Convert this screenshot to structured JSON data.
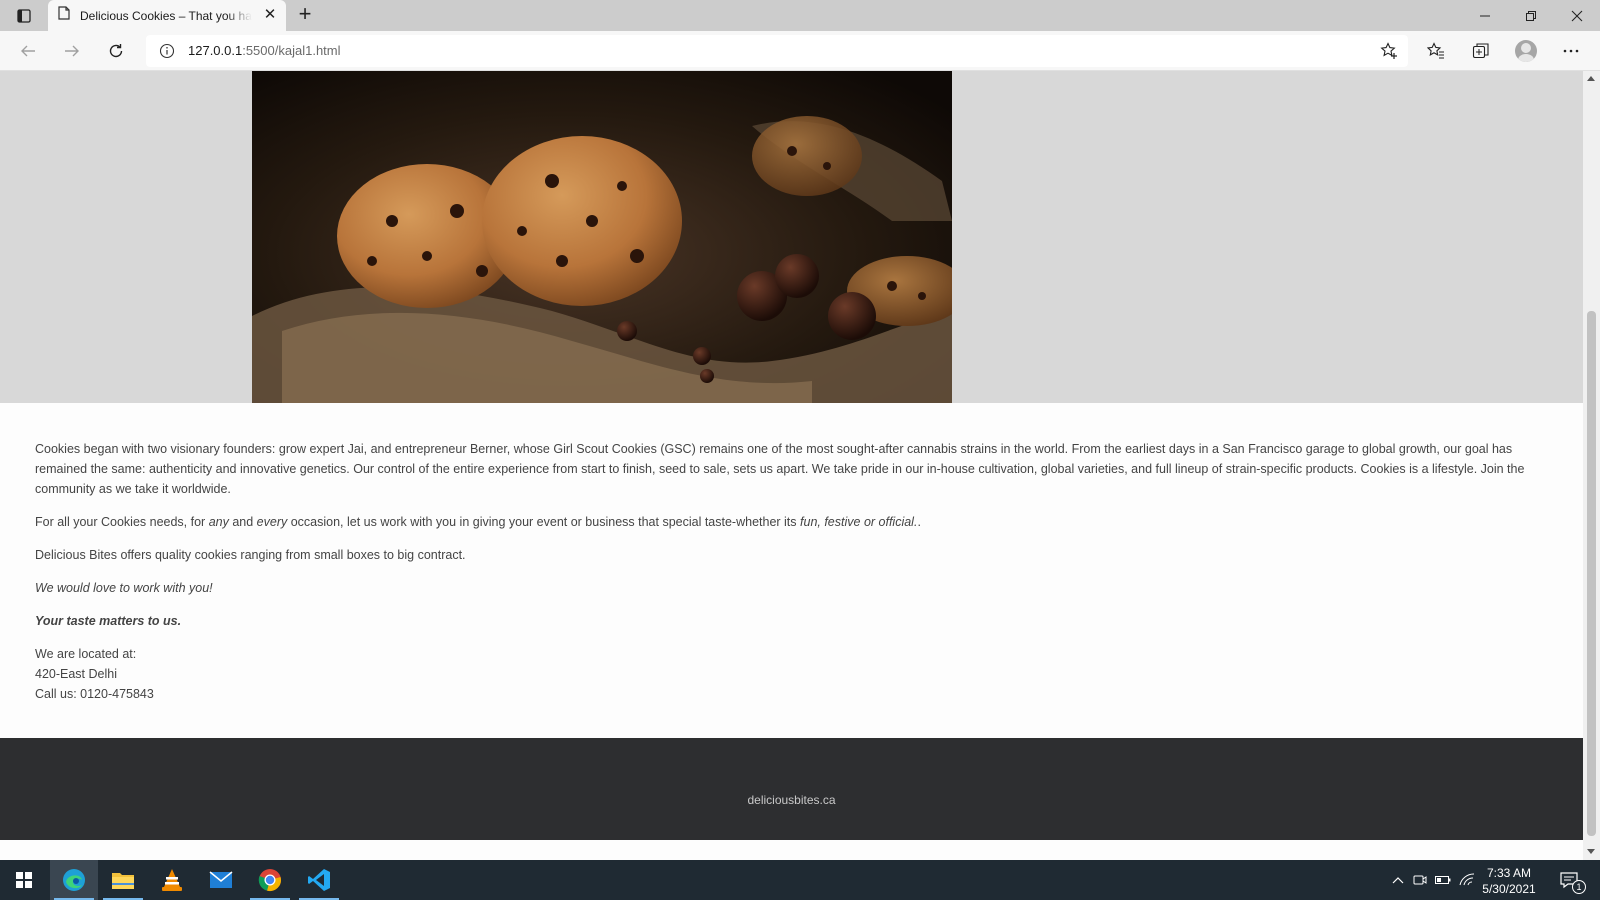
{
  "browser": {
    "tab_title": "Delicious Cookies – That you have",
    "tab_close": "✕",
    "new_tab": "+",
    "url_host": "127.0.0.1",
    "url_rest": ":5500/kajal1.html",
    "icons": {
      "tab_actions": "tab-actions-icon",
      "page": "page-icon",
      "back": "back-arrow-icon",
      "forward": "forward-arrow-icon",
      "refresh": "refresh-icon",
      "info": "info-icon",
      "add_favorite": "add-favorite-icon",
      "favorites": "favorites-icon",
      "collections": "collections-icon",
      "profile": "profile-avatar-icon",
      "more": "more-icon"
    }
  },
  "page": {
    "paragraphs": {
      "about": "Cookies began with two visionary founders: grow expert Jai, and entrepreneur Berner, whose Girl Scout Cookies (GSC) remains one of the most sought-after cannabis strains in the world. From the earliest days in a San Francisco garage to global growth, our goal has remained the same: authenticity and innovative genetics. Our control of the entire experience from start to finish, seed to sale, sets us apart. We take pride in our in-house cultivation, global varieties, and full lineup of strain-specific products. Cookies is a lifestyle. Join the community as we take it worldwide.",
      "needs_1": "For all your Cookies needs, for ",
      "needs_any": "any",
      "needs_2": " and ",
      "needs_every": "every",
      "needs_3": " occasion, let us work with you in giving your event or business that special taste-whether its ",
      "needs_occasions": "fun, festive or official.",
      "needs_4": ".",
      "offers": "Delicious Bites offers quality cookies ranging from small boxes to big contract.",
      "love": "We would love to work with you!",
      "taste": "Your taste matters to us.",
      "located_label": "We are located at:",
      "address": "420-East Delhi",
      "phone": "Call us: 0120-475843"
    },
    "footer": "deliciousbites.ca"
  },
  "taskbar": {
    "time": "7:33 AM",
    "date": "5/30/2021",
    "notification_count": "1",
    "apps": [
      "start-icon",
      "edge-icon",
      "file-explorer-icon",
      "vlc-icon",
      "mail-icon",
      "chrome-icon",
      "vscode-icon"
    ],
    "colors": {
      "vscode": "#23a9f2",
      "edge": "#1ea0d6",
      "chrome_red": "#db4437",
      "vlc": "#f08a00"
    }
  }
}
